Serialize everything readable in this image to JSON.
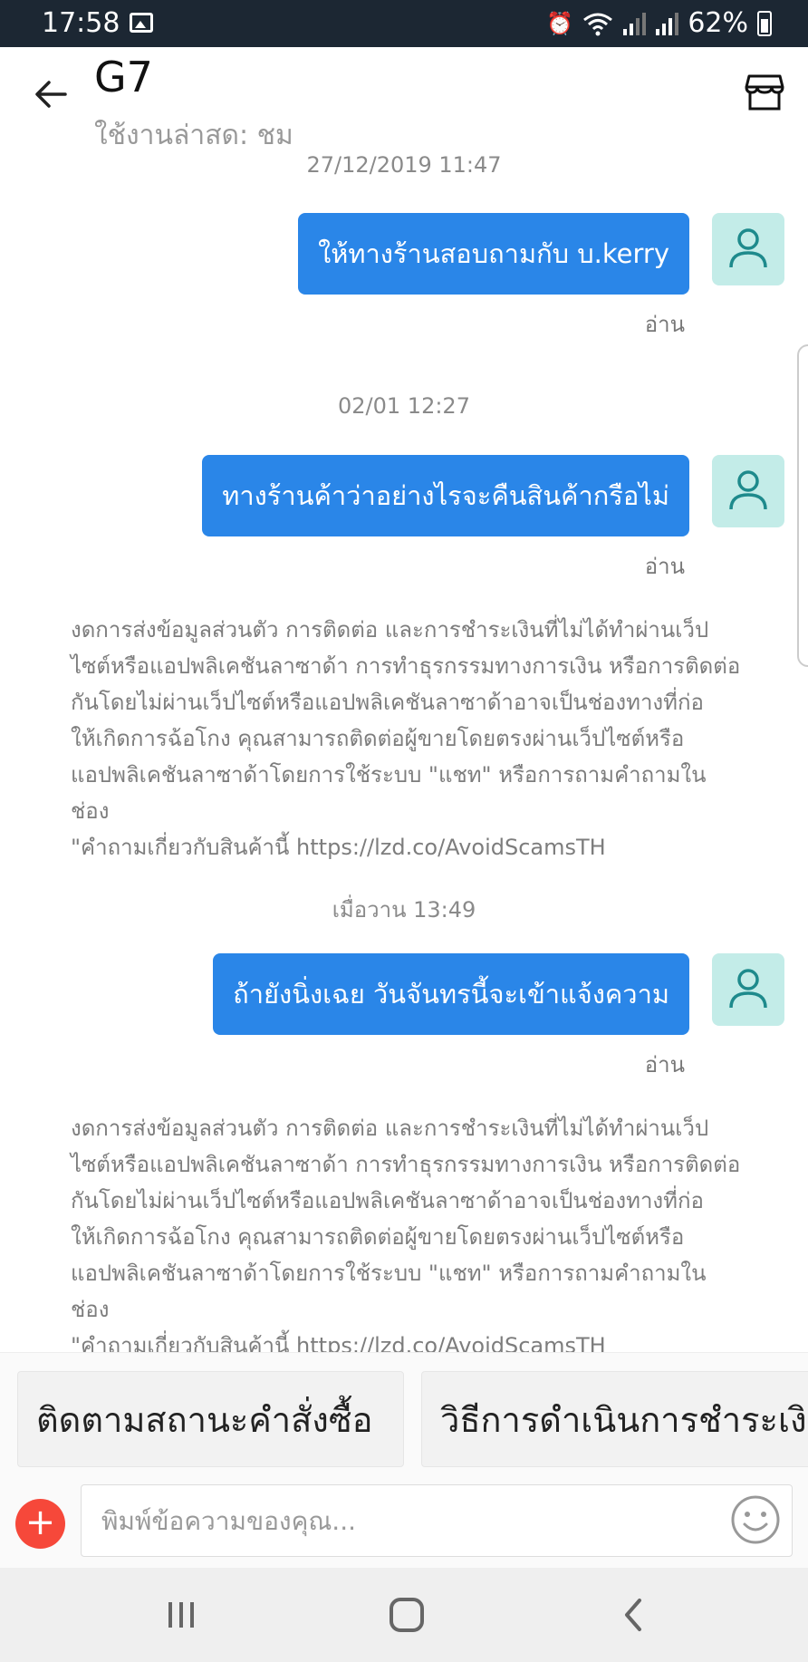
{
  "status_bar": {
    "time": "17:58",
    "battery": "62%"
  },
  "header": {
    "title": "G7",
    "subtitle": "ใช้งานล่าสุด: ชม"
  },
  "messages": [
    {
      "timestamp": "27/12/2019 11:47",
      "text": "ให้ทางร้านสอบถามกับ บ.kerry",
      "status": "อ่าน"
    },
    {
      "timestamp": "02/01 12:27",
      "text": "ทางร้านค้าว่าอย่างไรจะคืนสินค้ากรือไม่",
      "status": "อ่าน"
    },
    {
      "timestamp": "เมื่อวาน 13:49",
      "text": "ถ้ายังนิ่งเฉย วันจันทรนี้จะเข้าแจ้งความ",
      "status": "อ่าน"
    }
  ],
  "warning_lines": [
    "งดการส่งข้อมูลส่วนตัว การติดต่อ และการชำระเงินที่ไม่ได้ทำผ่านเว็ป",
    "ไซต์หรือแอปพลิเคชันลาซาด้า การทำธุรกรรมทางการเงิน หรือการติดต่อ",
    "กันโดยไม่ผ่านเว็ปไซต์หรือแอปพลิเคชันลาซาด้าอาจเป็นช่องทางที่ก่อ",
    "ให้เกิดการฉ้อโกง คุณสามารถติดต่อผู้ขายโดยตรงผ่านเว็ปไซต์หรือ",
    "แอปพลิเคชันลาซาด้าโดยการใช้ระบบ \"แชท\" หรือการถามคำถามในช่อง",
    "\"คำถามเกี่ยวกับสินค้านี้ https://lzd.co/AvoidScamsTH"
  ],
  "quick_replies": [
    "ติดตามสถานะคำสั่งซื้อ",
    "วิธีการดำเนินการชำระเงิน"
  ],
  "input": {
    "placeholder": "พิมพ์ข้อความของคุณ..."
  },
  "icons": {
    "back": "back-arrow-icon",
    "shop": "shop-icon",
    "avatar": "user-icon",
    "plus": "plus-icon",
    "emoji": "smiley-icon"
  },
  "colors": {
    "bubble": "#2a86e8",
    "avatar_bg": "#c3ece8",
    "plus": "#f6483a",
    "status_bar": "#1c2733"
  }
}
